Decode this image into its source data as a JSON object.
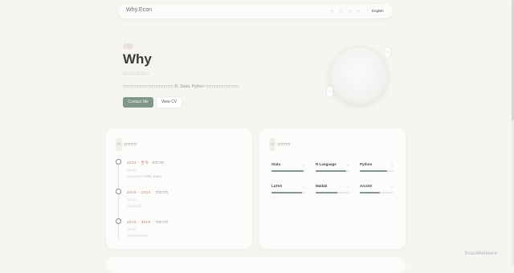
{
  "nav": {
    "brand": "Why.Econ",
    "links": [
      "□",
      "□",
      "□",
      "□"
    ],
    "language": "English"
  },
  "hero": {
    "badge": "▫▫",
    "title": "Why",
    "subtitle": "□□□□□□□",
    "description": "□□□□□□□□□□□□□□□□□□□□□ R, Stata, Python □□□□□□□□□□□□□□",
    "contact_label": "Contact Me",
    "cv_label": "View CV",
    "avatar_chip_top": "□",
    "avatar_chip_left": "□"
  },
  "education": {
    "icon": "□",
    "title": "□□□□",
    "entries": [
      {
        "year": "2023 - 至今",
        "degree": "□□□ □□",
        "school": "□□□ □□",
        "note": "□□□□□□□□□□□GPA: 3.9/4.0"
      },
      {
        "year": "2019 - 2023",
        "degree": "□□□ □□",
        "school": "□□□ □□",
        "note": "□□□□□□□□□"
      },
      {
        "year": "2015 - 2019",
        "degree": "□□□ □□",
        "school": "□□□ □□",
        "note": "□□□□□□□□□□□□"
      }
    ]
  },
  "skills": {
    "icon": "□",
    "title": "□□□□",
    "items": [
      {
        "name": "Stata",
        "level": 0.95
      },
      {
        "name": "R Language",
        "level": 0.9
      },
      {
        "name": "Python",
        "level": 0.8
      },
      {
        "name": "LaTeX",
        "level": 0.9
      },
      {
        "name": "Matlab",
        "level": 0.65
      },
      {
        "name": "ArcGIS",
        "level": 0.6
      }
    ],
    "item_icon": "□"
  },
  "colors": {
    "accent": "#7f968a",
    "year": "#c07a78",
    "background": "#f6f5f1"
  },
  "watermark": "ScanMalware"
}
